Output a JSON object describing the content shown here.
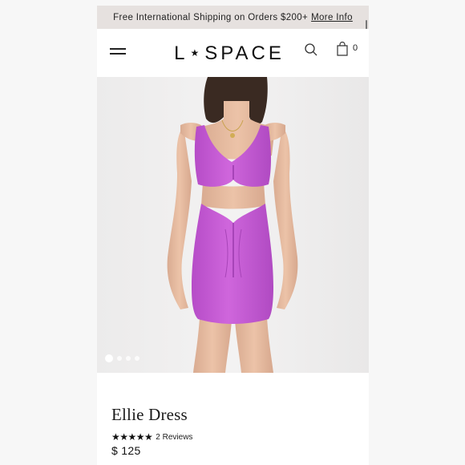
{
  "promo": {
    "text": "Free International Shipping on Orders $200+",
    "link": "More Info"
  },
  "header": {
    "logo_left": "L",
    "logo_star": "★",
    "logo_right": "SPACE",
    "cart_count": "0",
    "icons": [
      "menu-icon",
      "search-icon",
      "shopping-bag-icon"
    ]
  },
  "gallery": {
    "image": "product-photo",
    "slide_count": 4,
    "active_slide": 1
  },
  "product": {
    "title": "Ellie Dress",
    "stars": "★★★★★",
    "rating": 5,
    "reviews": "2 Reviews",
    "price": "$ 125"
  },
  "colors": {
    "promo_bg": "#e6e1df",
    "dress": "#c25ad0",
    "background": "#f0eeee"
  }
}
